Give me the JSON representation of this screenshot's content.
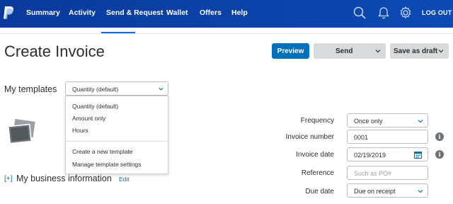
{
  "nav": {
    "items": [
      "Summary",
      "Activity",
      "Send & Request",
      "Wallet",
      "Offers",
      "Help"
    ],
    "logout": "LOG OUT"
  },
  "header": {
    "title": "Create Invoice",
    "preview": "Preview",
    "send": "Send",
    "save_draft": "Save as draft"
  },
  "templates": {
    "label": "My templates",
    "selected": "Quantity (default)",
    "options": [
      "Quantity (default)",
      "Amount only",
      "Hours"
    ],
    "actions": [
      "Create a new template",
      "Manage template settings"
    ]
  },
  "business": {
    "toggle": "[+]",
    "label": "My business information",
    "edit": "Edit"
  },
  "invoice": {
    "frequency_label": "Frequency",
    "frequency_value": "Once only",
    "number_label": "Invoice number",
    "number_value": "0001",
    "date_label": "Invoice date",
    "date_value": "02/19/2019",
    "reference_label": "Reference",
    "reference_placeholder": "Such as PO#",
    "due_label": "Due date",
    "due_value": "Due on receipt"
  },
  "colors": {
    "nav_bg": "#0a3fa3",
    "primary": "#0070ba",
    "secondary_btn": "#d9dadb"
  }
}
